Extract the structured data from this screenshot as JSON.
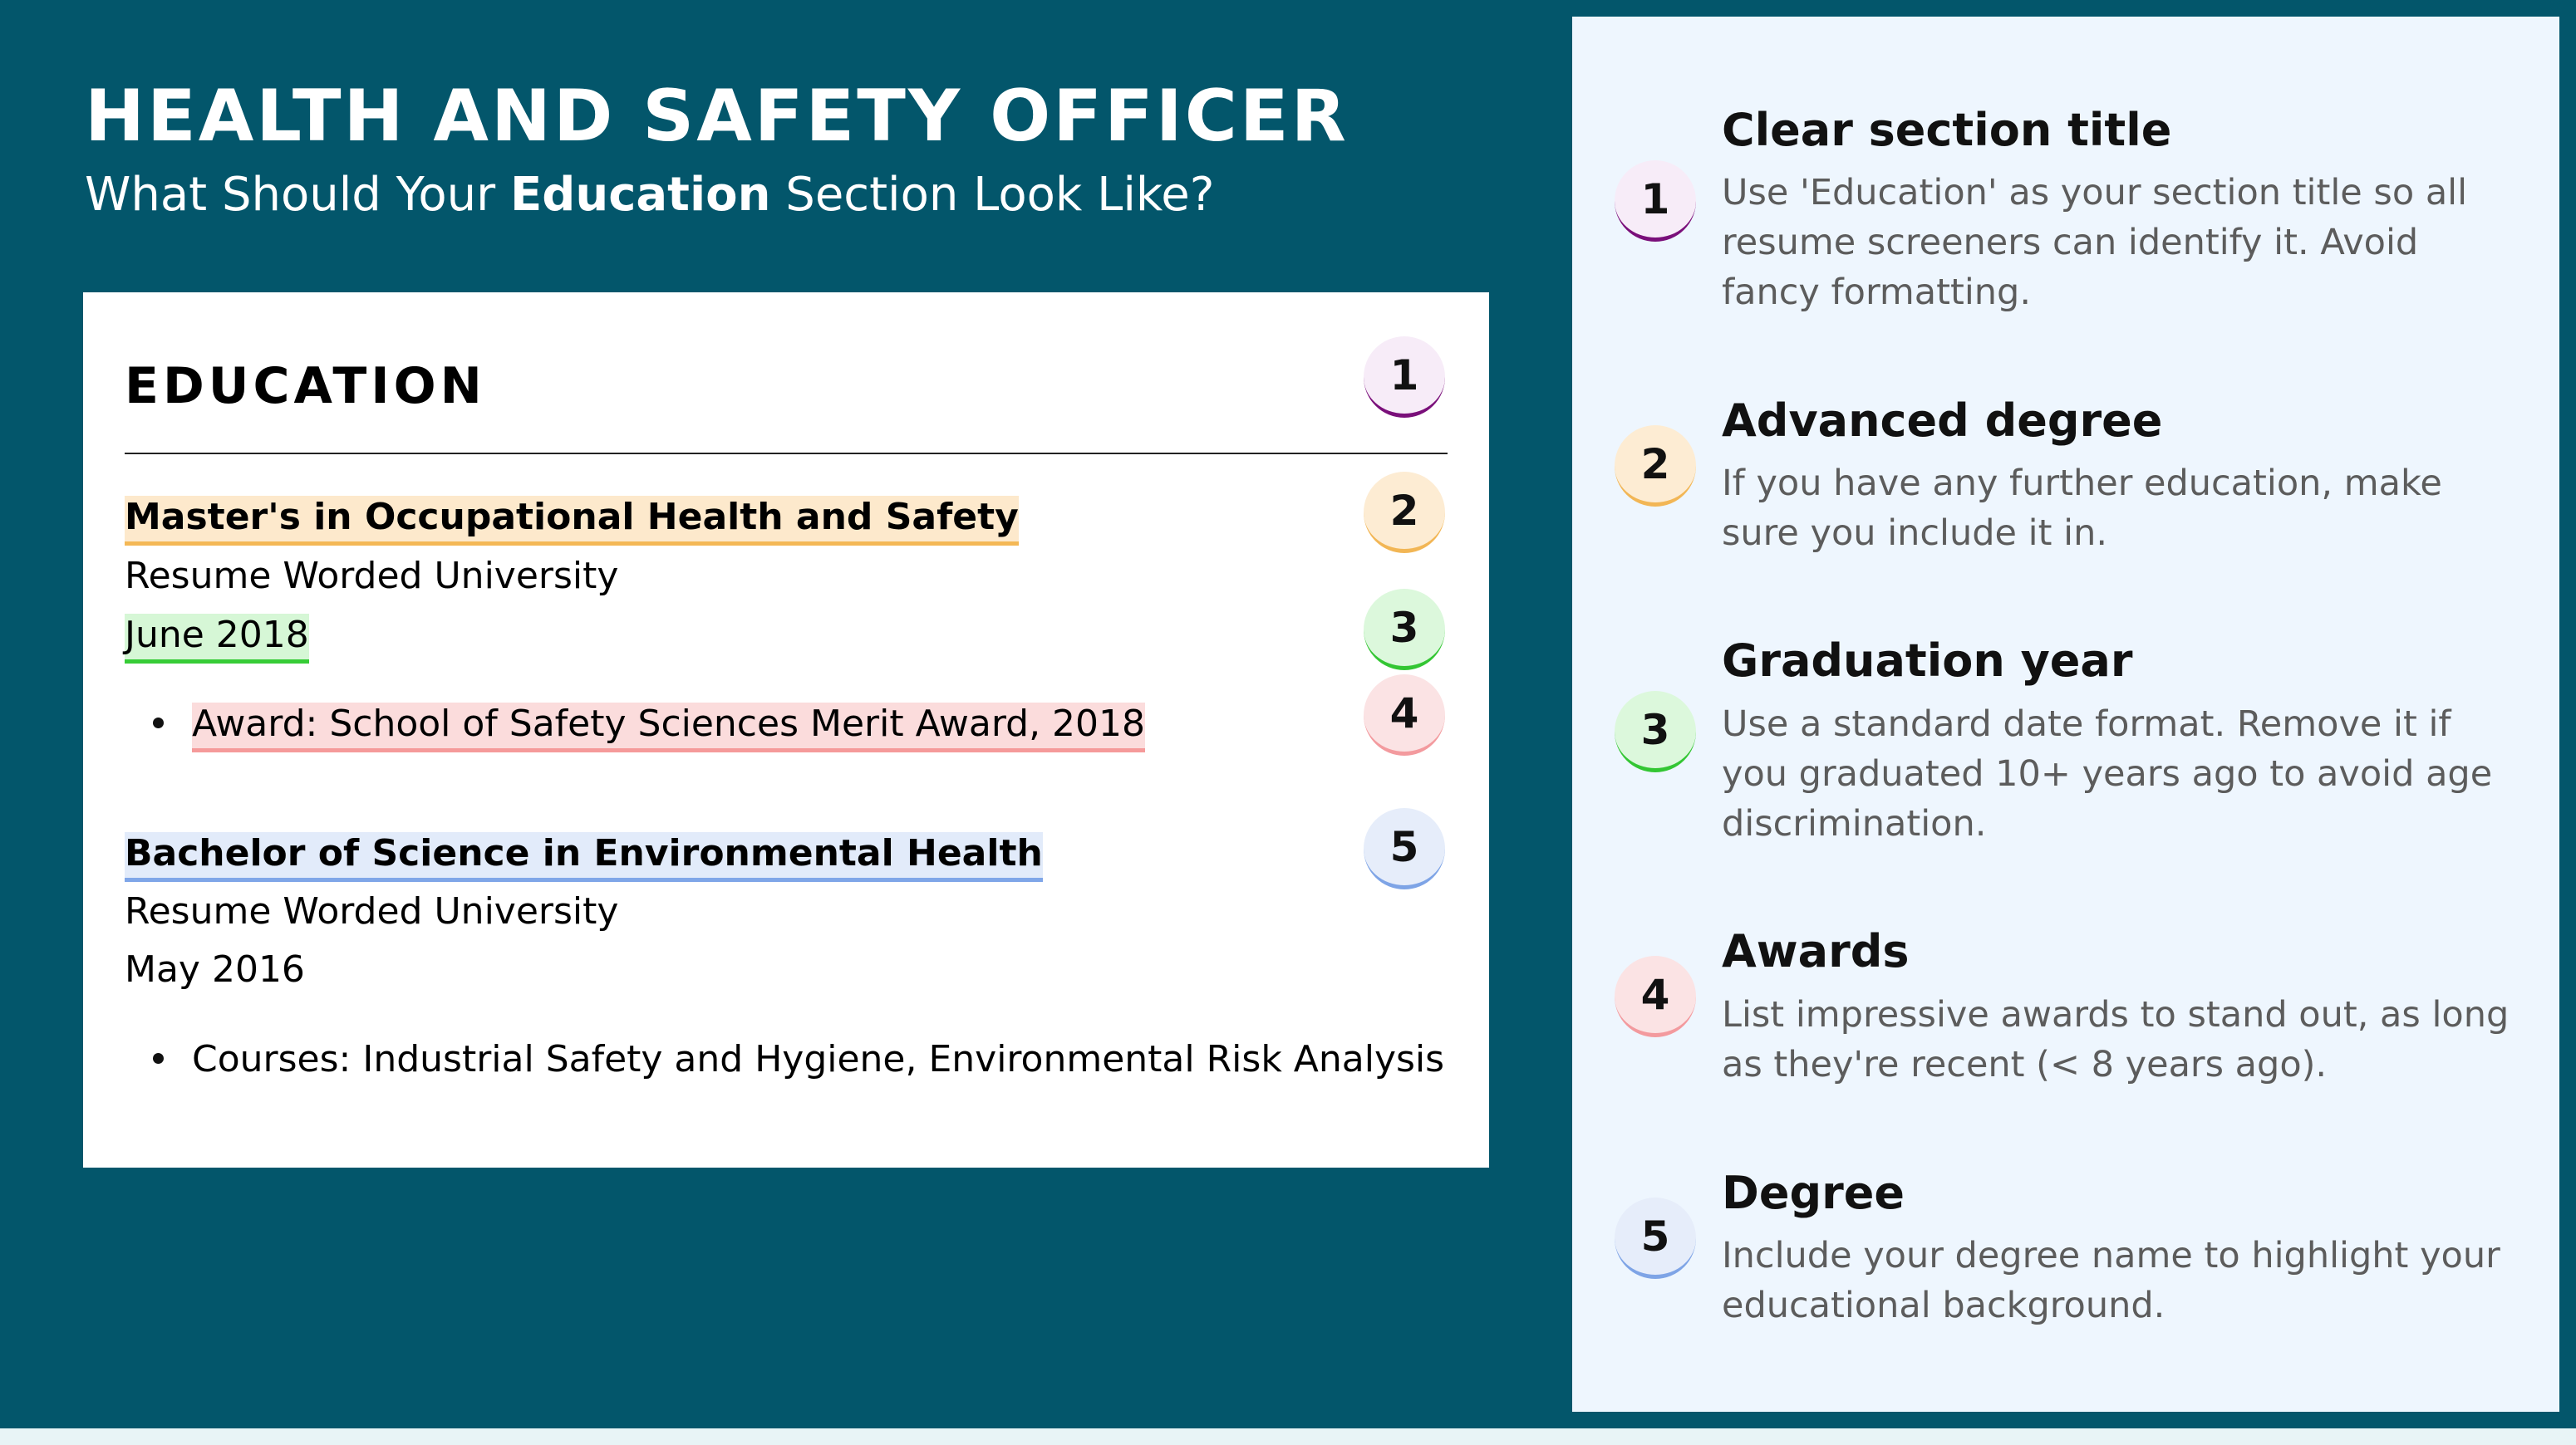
{
  "header": {
    "title": "HEALTH AND SAFETY OFFICER",
    "subtitle_before": "What Should Your ",
    "subtitle_bold": "Education",
    "subtitle_after": " Section Look Like?"
  },
  "resume": {
    "section_title": "EDUCATION",
    "entries": [
      {
        "degree": "Master's in Occupational Health and Safety",
        "school": "Resume Worded University",
        "date": "June 2018",
        "bullet": "Award: School of Safety Sciences Merit Award, 2018"
      },
      {
        "degree": "Bachelor of Science in Environmental Health",
        "school": "Resume Worded University",
        "date": "May 2016",
        "bullet": "Courses: Industrial Safety and Hygiene, Environmental Risk Analysis"
      }
    ],
    "badges": [
      "1",
      "2",
      "3",
      "4",
      "5"
    ]
  },
  "tips": [
    {
      "number": "1",
      "title": "Clear section title",
      "text": "Use 'Education' as your section title so all resume screeners can identify it. Avoid fancy formatting."
    },
    {
      "number": "2",
      "title": "Advanced degree",
      "text": "If you have any further education, make sure you include it in."
    },
    {
      "number": "3",
      "title": "Graduation year",
      "text": "Use a standard date format. Remove it if you graduated 10+ years ago to avoid age discrimination."
    },
    {
      "number": "4",
      "title": "Awards",
      "text": "List impressive awards to stand out, as long as they're recent (< 8 years ago)."
    },
    {
      "number": "5",
      "title": "Degree",
      "text": "Include your degree name to highlight your educational background."
    }
  ],
  "colors": {
    "background": "#03566b",
    "panel": "#eef6fe",
    "highlight_1": "#7a0f7a",
    "highlight_2": "#f2b655",
    "highlight_3": "#33c633",
    "highlight_4": "#f39a9e",
    "highlight_5": "#7ea4e6"
  }
}
